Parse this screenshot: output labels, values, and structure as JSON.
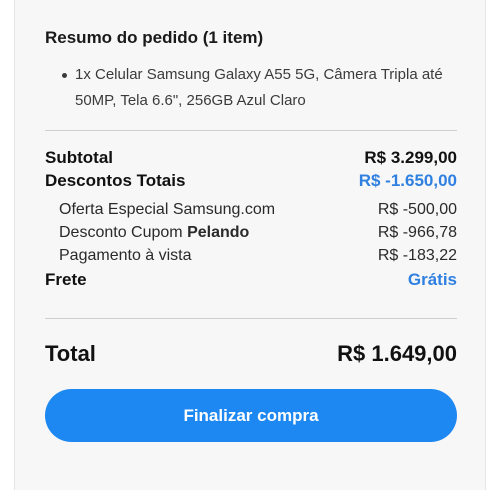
{
  "order_summary": {
    "title": "Resumo do pedido (1 item)",
    "items": [
      {
        "description": "1x Celular Samsung Galaxy A55 5G, Câmera Tripla até 50MP, Tela 6.6\", 256GB Azul Claro"
      }
    ],
    "subtotal": {
      "label": "Subtotal",
      "value": "R$ 3.299,00"
    },
    "total_discounts": {
      "label": "Descontos Totais",
      "value": "R$ -1.650,00",
      "color": "#2f80e0"
    },
    "discounts": [
      {
        "label": "Oferta Especial Samsung.com",
        "value": "R$ -500,00"
      },
      {
        "label_prefix": "Desconto Cupom ",
        "label_emphasis": "Pelando",
        "value": "R$ -966,78"
      },
      {
        "label": "Pagamento à vista",
        "value": "R$ -183,22"
      }
    ],
    "shipping": {
      "label": "Frete",
      "value": "Grátis",
      "color": "#2f80e0"
    },
    "total": {
      "label": "Total",
      "value": "R$ 1.649,00"
    },
    "checkout_button": {
      "label": "Finalizar compra",
      "color": "#1e88f2"
    }
  }
}
